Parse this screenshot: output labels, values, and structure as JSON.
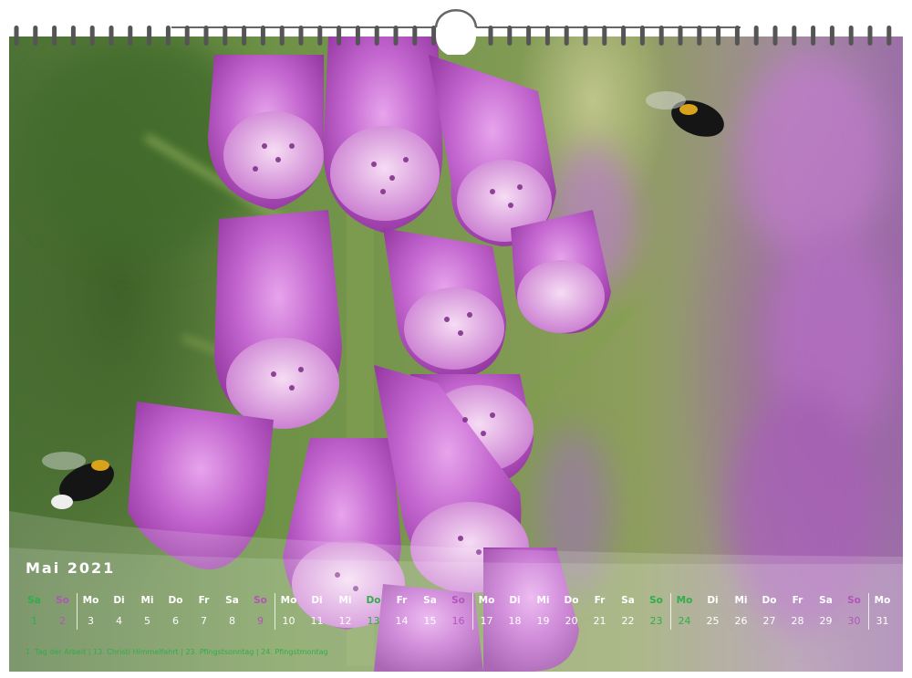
{
  "calendar": {
    "month_title": "Mai 2021",
    "days": [
      {
        "weekday": "Sa",
        "date": "1",
        "type": "holiday"
      },
      {
        "weekday": "So",
        "date": "2",
        "type": "sunday"
      },
      {
        "weekday": "Mo",
        "date": "3",
        "type": "normal"
      },
      {
        "weekday": "Di",
        "date": "4",
        "type": "normal"
      },
      {
        "weekday": "Mi",
        "date": "5",
        "type": "normal"
      },
      {
        "weekday": "Do",
        "date": "6",
        "type": "normal"
      },
      {
        "weekday": "Fr",
        "date": "7",
        "type": "normal"
      },
      {
        "weekday": "Sa",
        "date": "8",
        "type": "normal"
      },
      {
        "weekday": "So",
        "date": "9",
        "type": "sunday"
      },
      {
        "weekday": "Mo",
        "date": "10",
        "type": "normal"
      },
      {
        "weekday": "Di",
        "date": "11",
        "type": "normal"
      },
      {
        "weekday": "Mi",
        "date": "12",
        "type": "normal"
      },
      {
        "weekday": "Do",
        "date": "13",
        "type": "holiday"
      },
      {
        "weekday": "Fr",
        "date": "14",
        "type": "normal"
      },
      {
        "weekday": "Sa",
        "date": "15",
        "type": "normal"
      },
      {
        "weekday": "So",
        "date": "16",
        "type": "sunday"
      },
      {
        "weekday": "Mo",
        "date": "17",
        "type": "normal"
      },
      {
        "weekday": "Di",
        "date": "18",
        "type": "normal"
      },
      {
        "weekday": "Mi",
        "date": "19",
        "type": "normal"
      },
      {
        "weekday": "Do",
        "date": "20",
        "type": "normal"
      },
      {
        "weekday": "Fr",
        "date": "21",
        "type": "normal"
      },
      {
        "weekday": "Sa",
        "date": "22",
        "type": "normal"
      },
      {
        "weekday": "So",
        "date": "23",
        "type": "holiday"
      },
      {
        "weekday": "Mo",
        "date": "24",
        "type": "holiday"
      },
      {
        "weekday": "Di",
        "date": "25",
        "type": "normal"
      },
      {
        "weekday": "Mi",
        "date": "26",
        "type": "normal"
      },
      {
        "weekday": "Do",
        "date": "27",
        "type": "normal"
      },
      {
        "weekday": "Fr",
        "date": "28",
        "type": "normal"
      },
      {
        "weekday": "Sa",
        "date": "29",
        "type": "normal"
      },
      {
        "weekday": "So",
        "date": "30",
        "type": "sunday"
      },
      {
        "weekday": "Mo",
        "date": "31",
        "type": "normal"
      }
    ],
    "holidays_note": "1. Tag der Arbeit | 13. Christi Himmelfahrt | 23. Pfingstsonntag | 24. Pfingstmontag"
  },
  "colors": {
    "holiday": "#2fae4b",
    "sunday": "#b255b8",
    "normal": "#ffffff",
    "strip": "#ffffff",
    "binding": "#555555"
  },
  "icons": {
    "binding": "spiral-binding-icon",
    "hanger": "wall-hanger-icon"
  }
}
